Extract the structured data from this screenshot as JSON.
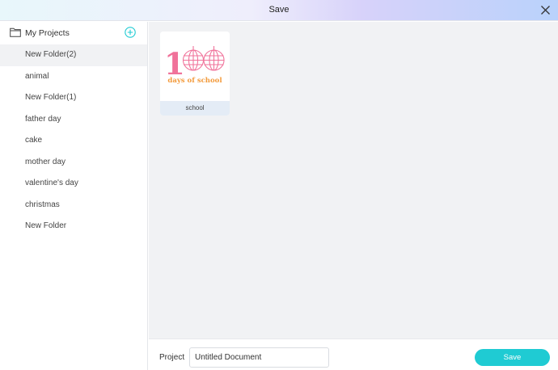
{
  "dialog": {
    "title": "Save"
  },
  "sidebar": {
    "title": "My Projects",
    "items": [
      {
        "label": "New Folder(2)",
        "active": true
      },
      {
        "label": "animal"
      },
      {
        "label": "New Folder(1)"
      },
      {
        "label": "father day"
      },
      {
        "label": "cake"
      },
      {
        "label": "mother day"
      },
      {
        "label": "valentine's day"
      },
      {
        "label": "christmas"
      },
      {
        "label": "New Folder"
      }
    ]
  },
  "main": {
    "cards": [
      {
        "label": "school",
        "thumb_number": "100",
        "thumb_text": "days of school"
      }
    ]
  },
  "footer": {
    "project_label": "Project",
    "project_value": "Untitled Document",
    "save_label": "Save"
  },
  "colors": {
    "accent": "#1fcbd3",
    "thumb_pink": "#f0729a",
    "thumb_orange": "#f39a3b"
  },
  "icons": {
    "close": "close-icon",
    "folder": "folder-icon",
    "add": "plus-circle-icon"
  }
}
